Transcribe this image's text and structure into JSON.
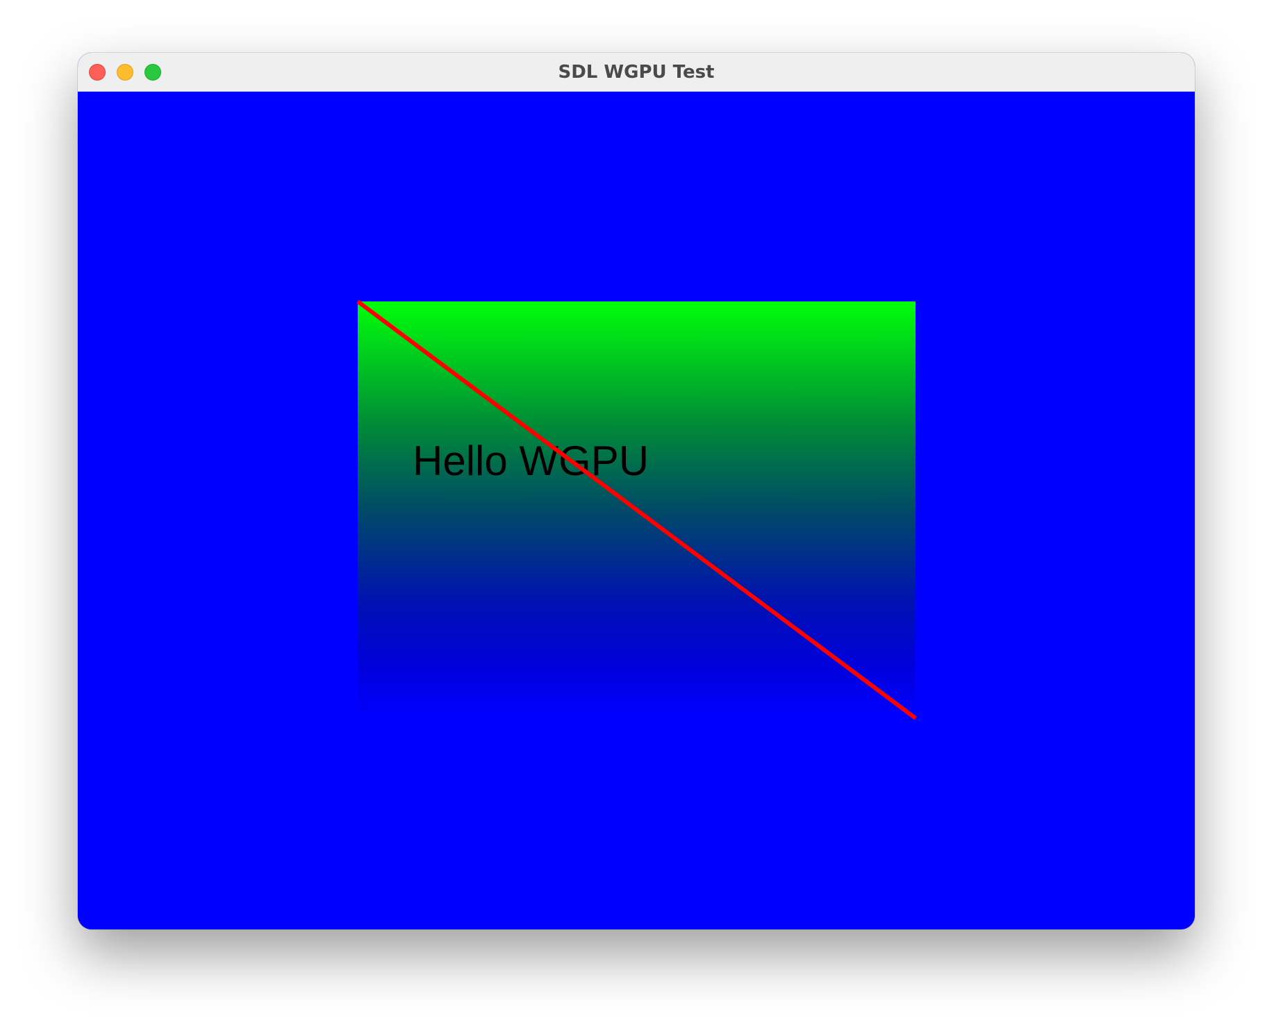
{
  "window": {
    "title": "SDL WGPU Test"
  },
  "scene": {
    "text": "Hello WGPU",
    "colors": {
      "background": "#0000ff",
      "gradient_top": "#00ff0a",
      "gradient_mid": "#005060",
      "gradient_bottom": "#0000ff",
      "line": "#ff0000",
      "text": "#000000"
    }
  }
}
